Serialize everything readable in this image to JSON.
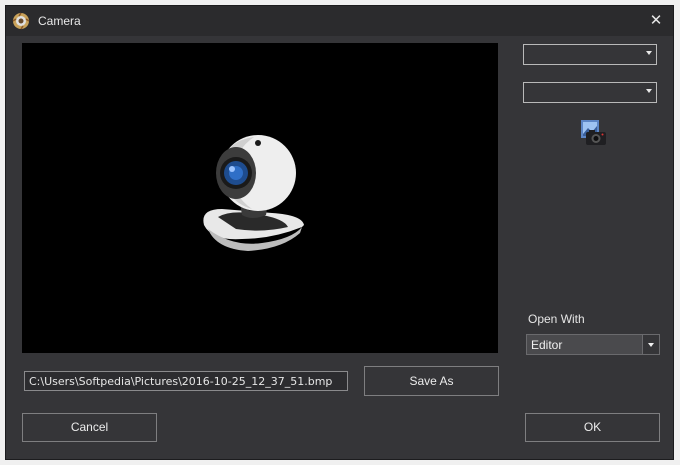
{
  "window": {
    "title": "Camera",
    "close_glyph": "✕"
  },
  "preview": {
    "placeholder_icon": "webcam-icon"
  },
  "camera_select": {
    "value": ""
  },
  "resolution_select": {
    "value": ""
  },
  "capture_button": {
    "icon": "photo-camera-icon"
  },
  "open_with": {
    "label": "Open With",
    "value": "Editor"
  },
  "save_path": {
    "value": "C:\\Users\\Softpedia\\Pictures\\2016-10-25_12_37_51.bmp"
  },
  "buttons": {
    "save_as": "Save As",
    "cancel": "Cancel",
    "ok": "OK"
  }
}
